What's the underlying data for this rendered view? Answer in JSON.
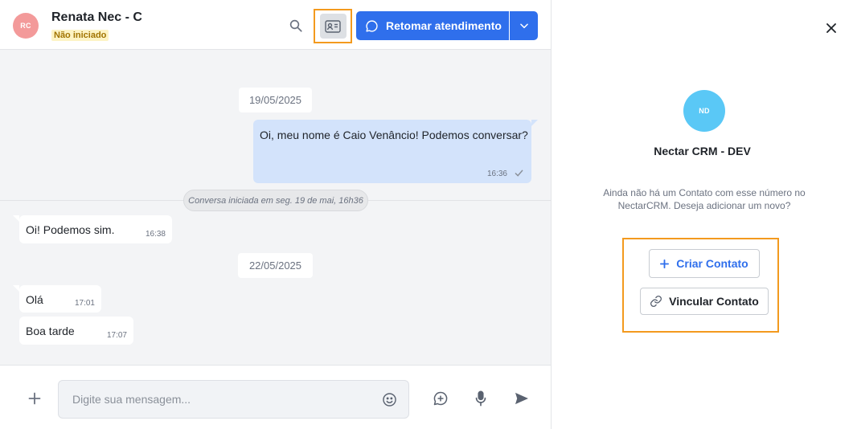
{
  "header": {
    "avatar_initials": "RC",
    "contact_name": "Renata Nec - C",
    "status": "Não iniciado",
    "resume_label": "Retomar atendimento"
  },
  "messages": {
    "date1": "19/05/2025",
    "out1_text": "Oi, meu nome é Caio Venâncio! Podemos conversar?",
    "out1_time": "16:36",
    "session_note": "Conversa iniciada em seg. 19 de mai, 16h36",
    "in1_text": "Oi! Podemos sim.",
    "in1_time": "16:38",
    "date2": "22/05/2025",
    "in2_text": "Olá",
    "in2_time": "17:01",
    "in3_text": "Boa tarde",
    "in3_time": "17:07"
  },
  "composer": {
    "placeholder": "Digite sua mensagem..."
  },
  "side_panel": {
    "avatar_initials": "ND",
    "title": "Nectar CRM - DEV",
    "message": "Ainda não há um Contato com esse número no NectarCRM. Deseja adicionar um novo?",
    "create_label": "Criar Contato",
    "link_label": "Vincular Contato"
  },
  "colors": {
    "accent": "#2f6fec",
    "highlight": "#f39a1e",
    "outgoing_bubble": "#d3e3fb",
    "background": "#f3f4f6"
  },
  "icons": [
    "search-icon",
    "contact-card-icon",
    "chat-bubble-icon",
    "chevron-down-icon",
    "plus-icon",
    "emoji-icon",
    "add-comment-icon",
    "mic-icon",
    "send-icon",
    "close-icon",
    "link-icon",
    "check-icon"
  ]
}
